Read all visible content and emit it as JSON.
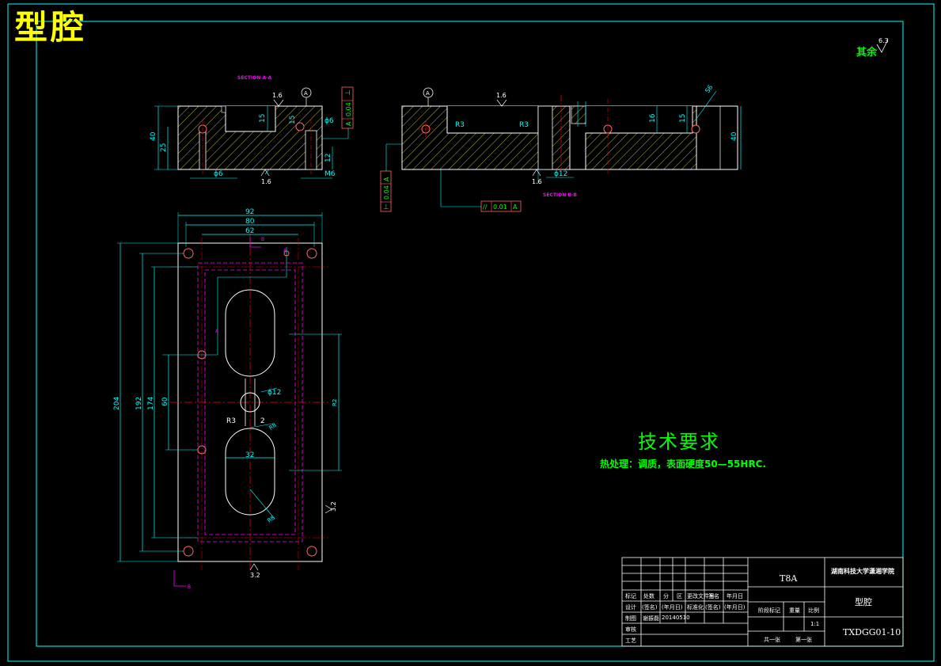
{
  "drawing": {
    "title": "型腔",
    "surface_roughness_rest": {
      "label": "其余",
      "value": "6.3"
    },
    "section_labels": {
      "left": "SECTION A-A",
      "right": "SECTION B-B"
    },
    "technical_requirements": {
      "heading": "技术要求",
      "text": "热处理：调质，表面硬度50—55HRC."
    },
    "front_view": {
      "dims": [
        "40",
        "25",
        "15",
        "15",
        "12",
        "ϕ6",
        "ϕ6",
        "M6",
        "1.6",
        "1.6"
      ],
      "datum": "A",
      "tolerance": {
        "symbol": "⊥",
        "value": "0.04",
        "datum": "A"
      }
    },
    "side_view": {
      "dims": [
        "R3",
        "R3",
        "ϕ12",
        "40",
        "16",
        "15",
        "1.6",
        "1.6",
        "S6"
      ],
      "datum": "A",
      "tolerance_left": {
        "symbol": "⊥",
        "value": "0.04",
        "datum": "A"
      },
      "tolerance_bottom": {
        "symbol": "//",
        "value": "0.01",
        "datum": "A"
      }
    },
    "top_view": {
      "dims_top": [
        "92",
        "80",
        "62"
      ],
      "dims_left": [
        "204",
        "192",
        "174",
        "60"
      ],
      "dims_inner": [
        "ϕ12",
        "R3",
        "2",
        "32",
        "R8",
        "R8",
        "R2"
      ],
      "roughness": [
        "3.2",
        "3.2"
      ],
      "section_marks": [
        "A",
        "A",
        "B",
        "B"
      ]
    },
    "title_block": {
      "material": "T8A",
      "school": "湖南科技大学潇湘学院",
      "part_name": "型腔",
      "drawing_no": "TXDGG01-10",
      "scale_label": "比例",
      "scale": "1:1",
      "stage_label": "阶段标记",
      "weight_label": "重量",
      "sheets_total": "共一张",
      "sheet_no": "第一张",
      "row_headers": [
        "标记",
        "处数",
        "分",
        "区",
        "更改文件号",
        "签名",
        "年月日"
      ],
      "design_row": [
        "设计",
        "(签名)",
        "(年月日)",
        "标准化",
        "(签名)",
        "(年月日)"
      ],
      "draw_row": [
        "制图",
        "谢振磊",
        "20140510"
      ],
      "review": "审核",
      "process": "工艺"
    },
    "colors": {
      "frame": "#00ffff",
      "outline": "#ffffff",
      "dimension": "#00ffff",
      "centerline": "#ff0000",
      "hidden": "#ff00ff",
      "text": "#00ff00",
      "title": "#ffff00"
    }
  }
}
